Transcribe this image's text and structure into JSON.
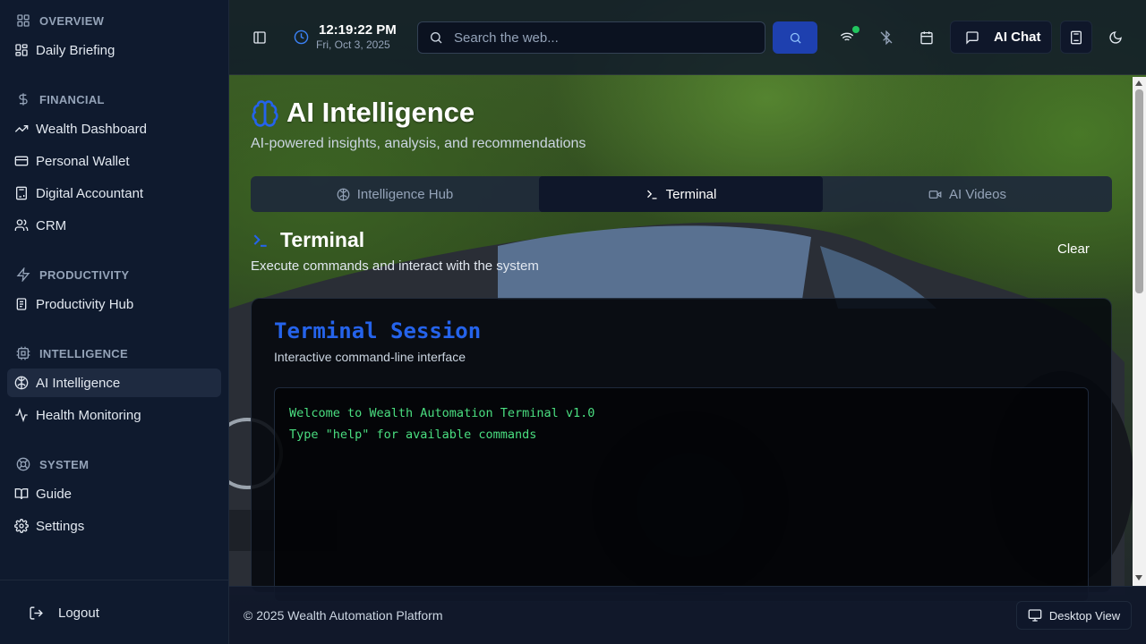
{
  "sidebar": {
    "sections": [
      {
        "title": "OVERVIEW",
        "icon": "grid-icon",
        "items": [
          {
            "label": "Daily Briefing",
            "icon": "grid-icon"
          }
        ]
      },
      {
        "title": "FINANCIAL",
        "icon": "dollar-icon",
        "items": [
          {
            "label": "Wealth Dashboard",
            "icon": "trending-up-icon"
          },
          {
            "label": "Personal Wallet",
            "icon": "wallet-icon"
          },
          {
            "label": "Digital Accountant",
            "icon": "calculator-icon"
          },
          {
            "label": "CRM",
            "icon": "users-icon"
          }
        ]
      },
      {
        "title": "PRODUCTIVITY",
        "icon": "zap-icon",
        "items": [
          {
            "label": "Productivity Hub",
            "icon": "clipboard-icon"
          }
        ]
      },
      {
        "title": "INTELLIGENCE",
        "icon": "cpu-icon",
        "items": [
          {
            "label": "AI Intelligence",
            "icon": "brain-icon",
            "active": true
          },
          {
            "label": "Health Monitoring",
            "icon": "activity-icon"
          }
        ]
      },
      {
        "title": "SYSTEM",
        "icon": "lifebuoy-icon",
        "items": [
          {
            "label": "Guide",
            "icon": "book-icon"
          },
          {
            "label": "Settings",
            "icon": "gear-icon"
          }
        ]
      }
    ],
    "logout": "Logout"
  },
  "header": {
    "time": "12:19:22 PM",
    "date": "Fri, Oct 3, 2025",
    "search_placeholder": "Search the web...",
    "ai_chat": "AI Chat"
  },
  "page": {
    "title": "AI Intelligence",
    "subtitle": "AI-powered insights, analysis, and recommendations",
    "tabs": [
      {
        "label": "Intelligence Hub",
        "icon": "brain-icon"
      },
      {
        "label": "Terminal",
        "icon": "terminal-icon",
        "active": true
      },
      {
        "label": "AI Videos",
        "icon": "video-icon"
      }
    ],
    "section_title": "Terminal",
    "section_subtitle": "Execute commands and interact with the system",
    "clear": "Clear",
    "card": {
      "title": "Terminal Session",
      "subtitle": "Interactive command-line interface",
      "lines": [
        "Welcome to Wealth Automation Terminal v1.0",
        "Type \"help\" for available commands"
      ]
    }
  },
  "footer": {
    "copyright": "© 2025 Wealth Automation Platform",
    "desktop_view": "Desktop View"
  },
  "colors": {
    "accent": "#2563eb",
    "terminal_text": "#4ade80",
    "sidebar_bg": "#0f1a2e",
    "online_dot": "#22c55e"
  }
}
